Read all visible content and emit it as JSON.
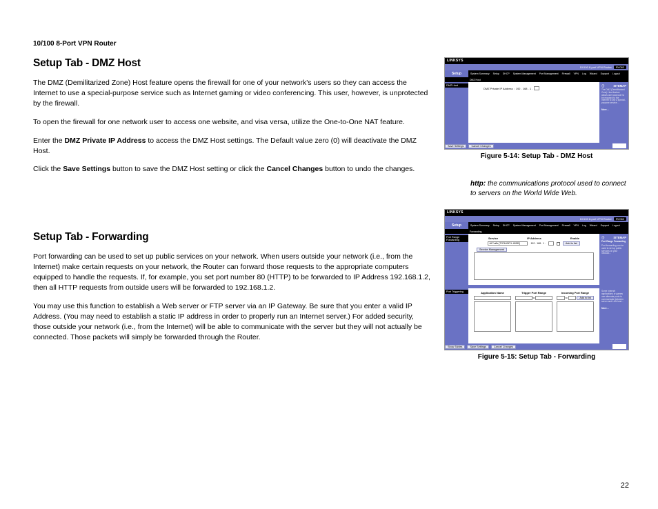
{
  "product_header": "10/100 8-Port VPN Router",
  "page_number": "22",
  "section1": {
    "title": "Setup Tab - DMZ Host",
    "p1": "The DMZ (Demilitarized Zone) Host feature opens the firewall for one of your network's users so they can access the Internet to use a special-purpose service such as Internet gaming or video conferencing. This user, however, is unprotected by the firewall.",
    "p2": "To open the firewall for one network user to access one website, and visa versa, utilize the One-to-One NAT feature.",
    "p3_a": "Enter the ",
    "p3_b": "DMZ Private IP Address",
    "p3_c": " to access the DMZ Host settings. The Default value zero (0) will deactivate the DMZ Host.",
    "p4_a": "Click the ",
    "p4_b": "Save Settings",
    "p4_c": " button to save the DMZ Host setting or click the ",
    "p4_d": "Cancel Changes",
    "p4_e": " button to undo the changes."
  },
  "section2": {
    "title": "Setup Tab - Forwarding",
    "p1": "Port forwarding can be used to set up public services on your network. When users outside your network (i.e., from the Internet) make certain requests on your network, the Router can forward those requests to the appropriate computers equipped to handle the requests. If, for example, you set port number 80 (HTTP) to be forwarded to IP Address 192.168.1.2, then all HTTP requests from outside users will be forwarded to 192.168.1.2.",
    "p2": "You may use this function to establish a Web server or FTP server via an IP Gateway. Be sure that you enter a valid IP Address. (You may need to establish a static IP address in order to properly run an Internet server.) For added security, those outside your network (i.e., from the Internet) will be able to communicate with the server but they will not actually be connected. Those packets will simply be forwarded through the Router."
  },
  "figure1": {
    "caption": "Figure 5-14: Setup Tab - DMZ Host",
    "brand": "LINKSYS",
    "titlebar_text": "10/100 8-port VPN Router",
    "model": "RV082",
    "setup_tab": "Setup",
    "tabs": [
      "System Summary",
      "Setup",
      "DHCP",
      "System Management",
      "Port Management",
      "Firewall",
      "VPN",
      "Log",
      "Wizard",
      "Support",
      "Logout"
    ],
    "subtabs_label_active": "DMZ Host",
    "left_label": "DMZ Host",
    "dmz_label": "DMZ Private IP Address :",
    "dmz_ip_prefix": "192 . 168 . 1 .",
    "sitemap": "SITEMAP",
    "btn_save": "Save Settings",
    "btn_cancel": "Cancel Changes"
  },
  "glossary": {
    "term": "http:",
    "def": " the communications protocol used to connect to servers on the World Wide Web."
  },
  "figure2": {
    "caption": "Figure 5-15: Setup Tab - Forwarding",
    "brand": "LINKSYS",
    "titlebar_text": "10/100 8-port VPN Router",
    "model": "RV082",
    "setup_tab": "Setup",
    "tabs": [
      "System Summary",
      "Setup",
      "DHCP",
      "System Management",
      "Port Management",
      "Firewall",
      "VPN",
      "Log",
      "Wizard",
      "Support",
      "Logout"
    ],
    "subtab_active": "Forwarding",
    "left1": "Port Range Forwarding",
    "left2": "Port Triggering",
    "hdr": [
      "Service",
      "IP Address",
      "Enable"
    ],
    "service_default": "All Traffic [TCP&UDP/1~65535]",
    "ip_prefix": "192 . 168 . 1 .",
    "btn_add": "Add to list",
    "btn_service": "Service Management",
    "cols3": [
      "Application Name",
      "Trigger Port Range",
      "Incoming Port Range"
    ],
    "to": "to",
    "btn_add2": "Add to list",
    "sitemap": "SITEMAP",
    "right_title": "Port Range Forwarding",
    "btn_show": "Show Tables",
    "btn_save": "Save Settings",
    "btn_cancel": "Cancel Changes"
  }
}
